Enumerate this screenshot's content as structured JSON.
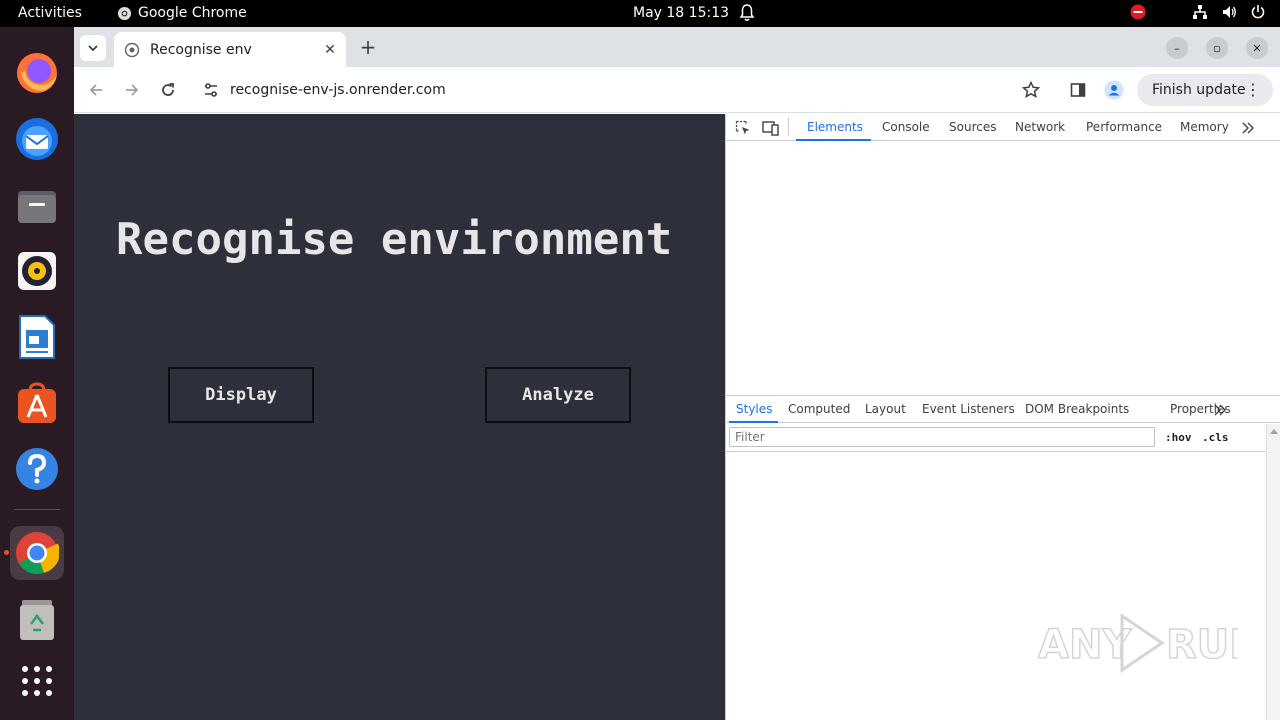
{
  "topbar": {
    "activities": "Activities",
    "app_name": "Google Chrome",
    "clock": "May 18  15:13"
  },
  "dock": {
    "items": [
      "firefox",
      "thunderbird",
      "files",
      "rhythmbox",
      "libreoffice-writer",
      "app-center",
      "help",
      "google-chrome",
      "trash",
      "show-apps"
    ]
  },
  "browser": {
    "tab_title": "Recognise env",
    "url": "recognise-env-js.onrender.com",
    "finish_update": "Finish update"
  },
  "page": {
    "heading": "Recognise environment",
    "display_button": "Display",
    "analyze_button": "Analyze",
    "background": "#2d2f3b"
  },
  "devtools": {
    "main_tabs": [
      "Elements",
      "Console",
      "Sources",
      "Network",
      "Performance",
      "Memory"
    ],
    "active_main_tab": "Elements",
    "sub_tabs": [
      "Styles",
      "Computed",
      "Layout",
      "Event Listeners",
      "DOM Breakpoints",
      "Properties"
    ],
    "active_sub_tab": "Styles",
    "filter_placeholder": "Filter",
    "hov": ":hov",
    "cls": ".cls"
  },
  "colors": {
    "accent": "#1a73e8",
    "ubuntu_orange": "#e95420"
  }
}
